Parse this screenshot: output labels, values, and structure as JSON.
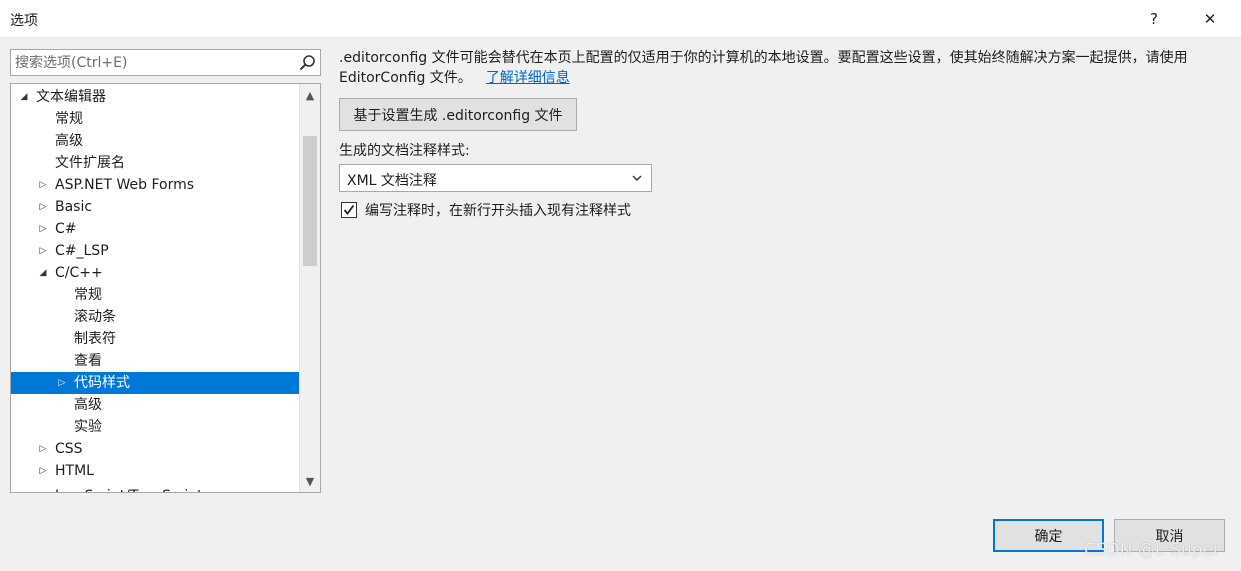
{
  "window": {
    "title": "选项",
    "help_label": "?",
    "close_label": "✕"
  },
  "search": {
    "placeholder": "搜索选项(Ctrl+E)",
    "value": ""
  },
  "tree": {
    "items": [
      {
        "label": "文本编辑器",
        "level": 0,
        "state": "expanded"
      },
      {
        "label": "常规",
        "level": 1,
        "state": "leaf"
      },
      {
        "label": "高级",
        "level": 1,
        "state": "leaf"
      },
      {
        "label": "文件扩展名",
        "level": 1,
        "state": "leaf"
      },
      {
        "label": "ASP.NET Web Forms",
        "level": 1,
        "state": "collapsed"
      },
      {
        "label": "Basic",
        "level": 1,
        "state": "collapsed"
      },
      {
        "label": "C#",
        "level": 1,
        "state": "collapsed"
      },
      {
        "label": "C#_LSP",
        "level": 1,
        "state": "collapsed"
      },
      {
        "label": "C/C++",
        "level": 1,
        "state": "expanded"
      },
      {
        "label": "常规",
        "level": 2,
        "state": "leaf"
      },
      {
        "label": "滚动条",
        "level": 2,
        "state": "leaf"
      },
      {
        "label": "制表符",
        "level": 2,
        "state": "leaf"
      },
      {
        "label": "查看",
        "level": 2,
        "state": "leaf"
      },
      {
        "label": "代码样式",
        "level": 2,
        "state": "collapsed",
        "selected": true
      },
      {
        "label": "高级",
        "level": 2,
        "state": "leaf"
      },
      {
        "label": "实验",
        "level": 2,
        "state": "leaf"
      },
      {
        "label": "CSS",
        "level": 1,
        "state": "collapsed"
      },
      {
        "label": "HTML",
        "level": 1,
        "state": "collapsed"
      },
      {
        "label": "JavaScript/TypeScript",
        "level": 1,
        "state": "collapsed",
        "cut": true
      }
    ]
  },
  "content": {
    "description": ".editorconfig 文件可能会替代在本页上配置的仅适用于你的计算机的本地设置。要配置这些设置，使其始终随解决方案一起提供，请使用 EditorConfig 文件。",
    "learn_more_link": "了解详细信息",
    "generate_button": "基于设置生成 .editorconfig 文件",
    "doc_comment_label": "生成的文档注释样式:",
    "doc_comment_selected": "XML 文档注释",
    "insert_checkbox_label": "编写注释时，在新行开头插入现有注释样式",
    "insert_checkbox_checked": true
  },
  "footer": {
    "ok_label": "确定",
    "cancel_label": "取消"
  },
  "watermark": "CSDN @L-Super",
  "colors": {
    "selection": "#0078d7",
    "link": "#0066cc"
  }
}
